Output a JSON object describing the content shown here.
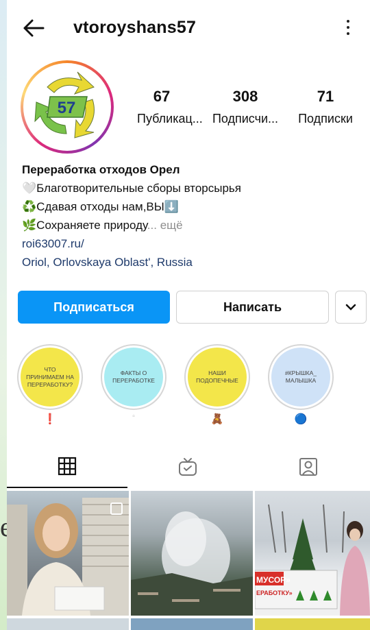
{
  "header": {
    "username": "vtoroyshans57"
  },
  "avatar": {
    "badge_text": "57"
  },
  "stats": [
    {
      "value": "67",
      "label": "Публикац..."
    },
    {
      "value": "308",
      "label": "Подписчи..."
    },
    {
      "value": "71",
      "label": "Подписки"
    }
  ],
  "bio": {
    "name": "Переработка отходов Орел",
    "line1": "🤍Благотворительные сборы вторсырья",
    "line2": "♻️Сдавая отходы нам,ВЫ⬇️",
    "line3": "🌿Сохраняете природу",
    "more": "... ещё",
    "link": "roi63007.ru/",
    "location": "Oriol, Orlovskaya Oblast', Russia"
  },
  "buttons": {
    "follow": "Подписаться",
    "message": "Написать"
  },
  "highlights": [
    {
      "text": "Что принимаем на переработку?",
      "caption": "❗",
      "color": "#f3e64a"
    },
    {
      "text": "Факты о переработке",
      "caption": "▫",
      "color": "#a9ecf2"
    },
    {
      "text": "Наши подопечные",
      "caption": "🧸",
      "color": "#f3e64a"
    },
    {
      "text": "#Крышка_ малышка",
      "caption": "🔵",
      "color": "#cfe2f7"
    }
  ],
  "grid": {
    "post3_banner": "МУСОР»",
    "post3_sub": "ЕРАБОТКУ»"
  },
  "colors": {
    "accent": "#0a95f6",
    "link": "#1e3a6b"
  }
}
